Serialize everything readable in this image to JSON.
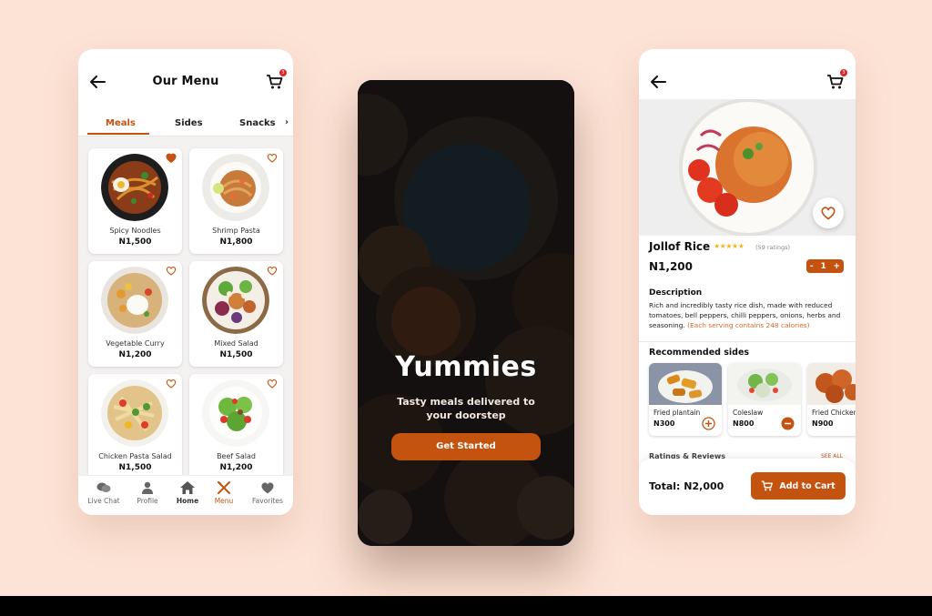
{
  "colors": {
    "background": "#fde3d6",
    "accent": "#c4530f",
    "badge": "#e0242b"
  },
  "menu_screen": {
    "title": "Our Menu",
    "cart_badge": "3",
    "tabs": [
      {
        "label": "Meals",
        "active": true
      },
      {
        "label": "Sides",
        "active": false
      },
      {
        "label": "Snacks",
        "active": false
      }
    ],
    "items": [
      {
        "name": "Spicy Noodles",
        "price": "N1,500",
        "favorited": true
      },
      {
        "name": "Shrimp Pasta",
        "price": "N1,800",
        "favorited": false
      },
      {
        "name": "Vegetable Curry",
        "price": "N1,200",
        "favorited": false
      },
      {
        "name": "Mixed Salad",
        "price": "N1,500",
        "favorited": false
      },
      {
        "name": "Chicken Pasta Salad",
        "price": "N1,500",
        "favorited": false
      },
      {
        "name": "Beef Salad",
        "price": "N1,200",
        "favorited": false
      }
    ],
    "nav": [
      {
        "label": "Live Chat",
        "icon": "chat-icon"
      },
      {
        "label": "Profile",
        "icon": "person-icon"
      },
      {
        "label": "Home",
        "icon": "home-icon"
      },
      {
        "label": "Menu",
        "icon": "cutlery-icon",
        "active": true
      },
      {
        "label": "Favorites",
        "icon": "heart-icon"
      }
    ]
  },
  "splash_screen": {
    "title": "Yummies",
    "subtitle_line1": "Tasty meals delivered to",
    "subtitle_line2": "your doorstep",
    "button": "Get Started"
  },
  "detail_screen": {
    "cart_badge": "3",
    "dish_name": "Jollof Rice",
    "stars": "★★★★★",
    "ratings": "(59 ratings)",
    "price": "N1,200",
    "quantity": {
      "minus": "-",
      "value": "1",
      "plus": "+"
    },
    "description_title": "Description",
    "description": "Rich and incredibly tasty rice dish, made with reduced tomatoes, bell peppers, chilli peppers, onions, herbs and seasoning.",
    "description_note": "(Each serving contains 248 calories)",
    "recommended_title": "Recommended sides",
    "sides": [
      {
        "name": "Fried plantain",
        "price": "N300",
        "action": "add"
      },
      {
        "name": "Coleslaw",
        "price": "N800",
        "action": "remove"
      },
      {
        "name": "Fried Chicken",
        "price": "N900",
        "action": "none"
      }
    ],
    "reviews_title": "Ratings & Reviews",
    "see_all": "SEE ALL",
    "total": "Total: N2,000",
    "add_to_cart": "Add to Cart"
  }
}
